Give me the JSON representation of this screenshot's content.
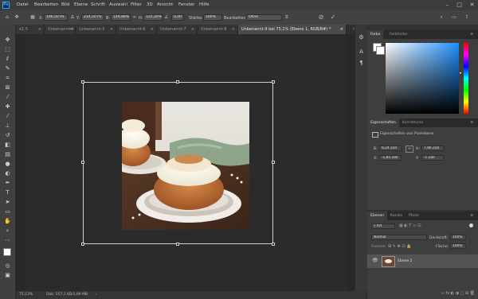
{
  "menubar": {
    "logo": "Ps",
    "items": [
      "Datei",
      "Bearbeiten",
      "Bild",
      "Ebene",
      "Schrift",
      "Auswahl",
      "Filter",
      "3D",
      "Ansicht",
      "Fenster",
      "Hilfe"
    ]
  },
  "options": {
    "x_label": "X:",
    "x_value": "196,50 Px",
    "y_label": "Y:",
    "y_value": "214,50 Px",
    "b_label": "B:",
    "b_value": "149,48%",
    "h_label": "H:",
    "h_value": "125,30%",
    "angle_value": "0,00",
    "interp_label": "Stärke:",
    "interp_value": "100%",
    "blend_label": "Bearbeiten:",
    "blend_value": "Ohne"
  },
  "tabs": [
    {
      "label": "e1.5"
    },
    {
      "label": "Unbenannt-4"
    },
    {
      "label": "Unbenannt-5"
    },
    {
      "label": "Unbenannt-6"
    },
    {
      "label": "Unbenannt-7"
    },
    {
      "label": "Unbenannt-8"
    },
    {
      "label": "Unbenannt-9 bei 75,1% (Ebene 1, RGB/8#) *"
    }
  ],
  "status": {
    "zoom": "75,13%",
    "doc": "Dok: 557,1 KB/1,09 MB"
  },
  "color_panel": {
    "tab_active": "Farbe",
    "tab_other": "Farbfelder"
  },
  "properties_panel": {
    "tab_active": "Eigenschaften",
    "tab_other": "Korrekturen",
    "section": "Eigenschaften von Pixelebene",
    "w_label": "B:",
    "w_value": "9,24 Zoll",
    "h_label": "H:",
    "h_value": "7,96 Zoll",
    "x_label": "X:",
    "x_value": "-1,85 Zoll",
    "y_label": "Y:",
    "y_value": "-1 Zoll"
  },
  "layers_panel": {
    "tab_active": "Ebenen",
    "tab_kanaele": "Kanäle",
    "tab_pfade": "Pfade",
    "search_placeholder": "Art",
    "blend_mode": "Normal",
    "opacity_label": "Deckkraft:",
    "opacity_value": "100%",
    "fill_label": "Fläche:",
    "fill_value": "100%",
    "lock_label": "Fixieren:",
    "layer_name": "Ebene 1"
  },
  "colors": {
    "accent": "#31a8ff",
    "background": "#282828",
    "panel": "#3e3e3e"
  }
}
